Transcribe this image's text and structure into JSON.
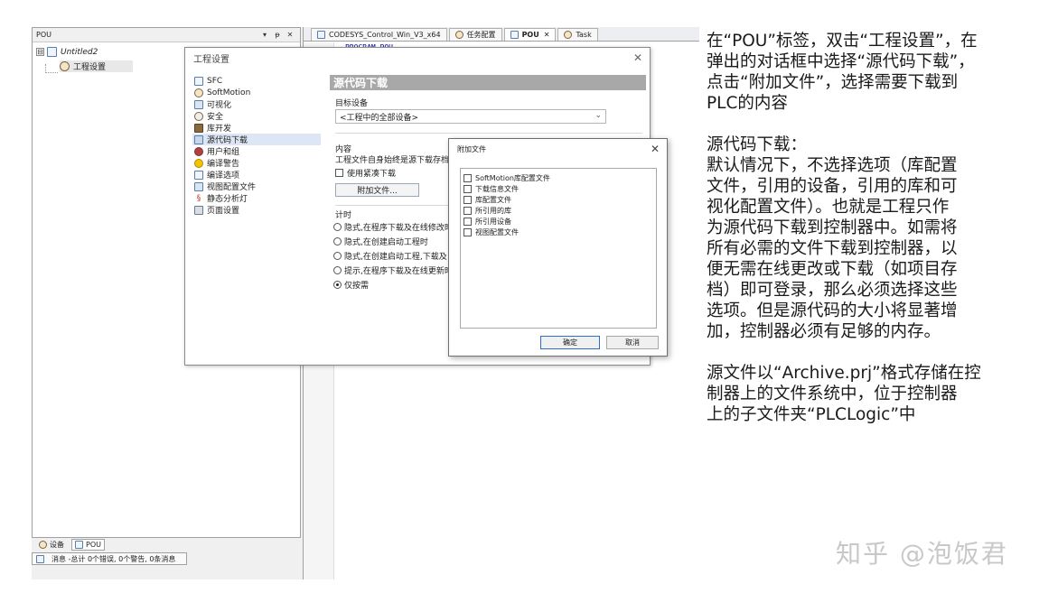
{
  "ide": {
    "pou_pane": {
      "title": "POU",
      "pin_symbol": "▾",
      "dock_symbol": "ᵽ",
      "close_symbol": "✕",
      "tree": {
        "root_expander": "⊟",
        "root_label": "Untitled2",
        "child_label": "工程设置"
      }
    },
    "bottom_tabs": [
      {
        "label": "设备"
      },
      {
        "label": "POU"
      }
    ],
    "message_bar": {
      "text": "消息 -总计 0个错误, 0个警告, 0条消息"
    },
    "doc_tabs": [
      {
        "label": "CODESYS_Control_Win_V3_x64",
        "active": false
      },
      {
        "label": "任务配置",
        "active": false
      },
      {
        "label": "POU",
        "active": true,
        "close": "✕"
      },
      {
        "label": "Task",
        "active": false
      }
    ],
    "code_line": "PROGRAM POU"
  },
  "settings_dialog": {
    "title": "工程设置",
    "close_symbol": "✕",
    "nav": [
      {
        "label": "SFC",
        "icon": "sfc-icon"
      },
      {
        "label": "SoftMotion",
        "icon": "softmotion-icon"
      },
      {
        "label": "可视化",
        "icon": "visualization-icon"
      },
      {
        "label": "安全",
        "icon": "security-icon"
      },
      {
        "label": "库开发",
        "icon": "library-icon"
      },
      {
        "label": "源代码下载",
        "icon": "source-download-icon",
        "selected": true
      },
      {
        "label": "用户和组",
        "icon": "users-icon"
      },
      {
        "label": "编译警告",
        "icon": "warning-icon"
      },
      {
        "label": "编译选项",
        "icon": "compile-options-icon"
      },
      {
        "label": "视图配置文件",
        "icon": "view-profile-icon"
      },
      {
        "label": "静态分析灯",
        "icon": "static-analysis-icon"
      },
      {
        "label": "页面设置",
        "icon": "page-setup-icon"
      }
    ],
    "panel": {
      "header": "源代码下载",
      "target_label": "目标设备",
      "target_value": "<工程中的全部设备>",
      "content_label": "内容",
      "content_desc": "工程文件自身始终是源下载存档",
      "compact_label": "使用紧凑下载",
      "add_files_button": "附加文件...",
      "timing_label": "计时",
      "timing_options": [
        {
          "label": "隐式,在程序下载及在线修改时",
          "selected": false
        },
        {
          "label": "隐式,在创建启动工程时",
          "selected": false
        },
        {
          "label": "隐式,在创建启动工程,下载及",
          "selected": false
        },
        {
          "label": "提示,在程序下载及在线更新时",
          "selected": false
        },
        {
          "label": "仅按需",
          "selected": true
        }
      ]
    }
  },
  "files_dialog": {
    "title": "附加文件",
    "close_symbol": "✕",
    "items": [
      {
        "label": "SoftMotion库配置文件",
        "checked": false
      },
      {
        "label": "下载信息文件",
        "checked": false
      },
      {
        "label": "库配置文件",
        "checked": false
      },
      {
        "label": "所引用的库",
        "checked": false
      },
      {
        "label": "所引用设备",
        "checked": false
      },
      {
        "label": "视图配置文件",
        "checked": false
      }
    ],
    "ok_button": "确定",
    "cancel_button": "取消"
  },
  "notes": {
    "para1": [
      "在“POU”标签，双击“工程设置”，在",
      "弹出的对话框中选择“源代码下载”，",
      "点击“附加文件”，选择需要下载到",
      "PLC的内容"
    ],
    "para2": [
      "源代码下载：",
      "默认情况下，不选择选项（库配置",
      "文件，引用的设备，引用的库和可",
      "视化配置文件）。也就是工程只作",
      "为源代码下载到控制器中。如需将",
      "所有必需的文件下载到控制器，以",
      "便无需在线更改或下载（如项目存",
      "档）即可登录，那么必须选择这些",
      "选项。但是源代码的大小将显著增",
      "加，控制器必须有足够的内存。"
    ],
    "para3": [
      "源文件以“Archive.prj”格式存储在控",
      "制器上的文件系统中，位于控制器",
      "上的子文件夹“PLCLogic”中"
    ]
  },
  "watermark": "知乎 @泡饭君"
}
